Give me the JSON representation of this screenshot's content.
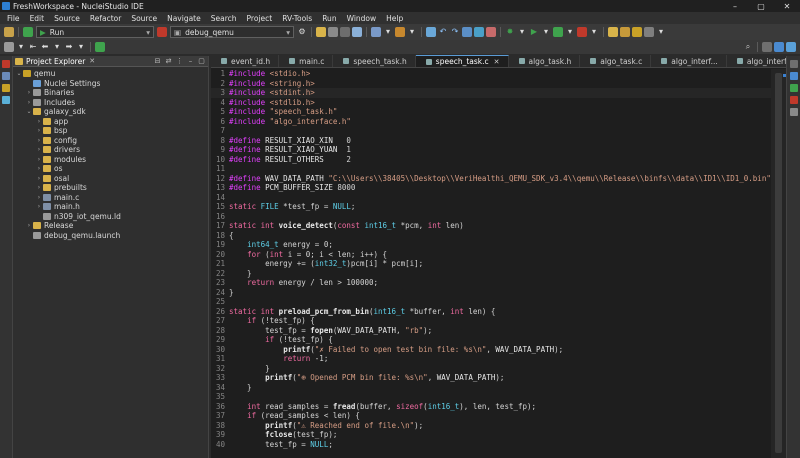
{
  "window": {
    "title": "FreshWorkspace - NucleiStudio IDE"
  },
  "menu": [
    "File",
    "Edit",
    "Source",
    "Refactor",
    "Source",
    "Navigate",
    "Search",
    "Project",
    "RV-Tools",
    "Run",
    "Window",
    "Help"
  ],
  "toolbar": {
    "run_mode": "Run",
    "launch_config": "debug_qemu"
  },
  "explorer": {
    "title": "Project Explorer",
    "tree": [
      {
        "label": "qemu",
        "depth": 0,
        "twisty": "v",
        "color": "#c9a227"
      },
      {
        "label": "Nuclei Settings",
        "depth": 1,
        "twisty": "",
        "color": "#6aa0d8"
      },
      {
        "label": "Binaries",
        "depth": 1,
        "twisty": ">",
        "color": "#9a9a9a"
      },
      {
        "label": "Includes",
        "depth": 1,
        "twisty": ">",
        "color": "#9a9a9a"
      },
      {
        "label": "galaxy_sdk",
        "depth": 1,
        "twisty": "v",
        "color": "#d8b24a"
      },
      {
        "label": "app",
        "depth": 2,
        "twisty": ">",
        "color": "#d8b24a"
      },
      {
        "label": "bsp",
        "depth": 2,
        "twisty": ">",
        "color": "#d8b24a"
      },
      {
        "label": "config",
        "depth": 2,
        "twisty": ">",
        "color": "#d8b24a"
      },
      {
        "label": "drivers",
        "depth": 2,
        "twisty": ">",
        "color": "#d8b24a"
      },
      {
        "label": "modules",
        "depth": 2,
        "twisty": ">",
        "color": "#d8b24a"
      },
      {
        "label": "os",
        "depth": 2,
        "twisty": ">",
        "color": "#d8b24a"
      },
      {
        "label": "osal",
        "depth": 2,
        "twisty": ">",
        "color": "#d8b24a"
      },
      {
        "label": "prebuilts",
        "depth": 2,
        "twisty": ">",
        "color": "#d8b24a"
      },
      {
        "label": "main.c",
        "depth": 2,
        "twisty": ">",
        "color": "#7f8fa6"
      },
      {
        "label": "main.h",
        "depth": 2,
        "twisty": ">",
        "color": "#7f8fa6"
      },
      {
        "label": "n309_iot_qemu.ld",
        "depth": 2,
        "twisty": "",
        "color": "#9a9a9a"
      },
      {
        "label": "Release",
        "depth": 1,
        "twisty": ">",
        "color": "#d8b24a"
      },
      {
        "label": "debug_qemu.launch",
        "depth": 1,
        "twisty": "",
        "color": "#9a9a9a"
      }
    ]
  },
  "editor": {
    "tabs": [
      {
        "label": "event_id.h",
        "active": false
      },
      {
        "label": "main.c",
        "active": false
      },
      {
        "label": "speech_task.h",
        "active": false
      },
      {
        "label": "speech_task.c",
        "active": true
      },
      {
        "label": "algo_task.h",
        "active": false
      },
      {
        "label": "algo_task.c",
        "active": false
      },
      {
        "label": "algo_interf...",
        "active": false
      },
      {
        "label": "algo_interf...",
        "active": false
      }
    ],
    "tabs_overflow": "»4",
    "lines": [
      "#include <stdio.h>",
      "#include <string.h>",
      "#include <stdint.h>",
      "#include <stdlib.h>",
      "#include \"speech_task.h\"",
      "#include \"algo_interface.h\"",
      "",
      "#define RESULT_XIAO_XIN   0",
      "#define RESULT_XIAO_YUAN  1",
      "#define RESULT_OTHERS     2",
      "",
      "#define WAV_DATA_PATH \"C:\\\\Users\\\\38405\\\\Desktop\\\\VeriHealthi_QEMU_SDK_v3.4\\\\qemu\\\\Release\\\\binfs\\\\data\\\\ID1\\\\ID1_0.bin\"",
      "#define PCM_BUFFER_SIZE 8000",
      "",
      "static FILE *test_fp = NULL;",
      "",
      "static int voice_detect(const int16_t *pcm, int len)",
      "{",
      "    int64_t energy = 0;",
      "    for (int i = 0; i < len; i++) {",
      "        energy += (int32_t)pcm[i] * pcm[i];",
      "    }",
      "    return energy / len > 100000;",
      "}",
      "",
      "static int preload_pcm_from_bin(int16_t *buffer, int len) {",
      "    if (!test_fp) {",
      "        test_fp = fopen(WAV_DATA_PATH, \"rb\");",
      "        if (!test_fp) {",
      "            printf(\"✗ Failed to open test bin file: %s\\n\", WAV_DATA_PATH);",
      "            return -1;",
      "        }",
      "        printf(\"⊕ Opened PCM bin file: %s\\n\", WAV_DATA_PATH);",
      "    }",
      "",
      "    int read_samples = fread(buffer, sizeof(int16_t), len, test_fp);",
      "    if (read_samples < len) {",
      "        printf(\"⚠ Reached end of file.\\n\");",
      "        fclose(test_fp);",
      "        test_fp = NULL;"
    ]
  }
}
